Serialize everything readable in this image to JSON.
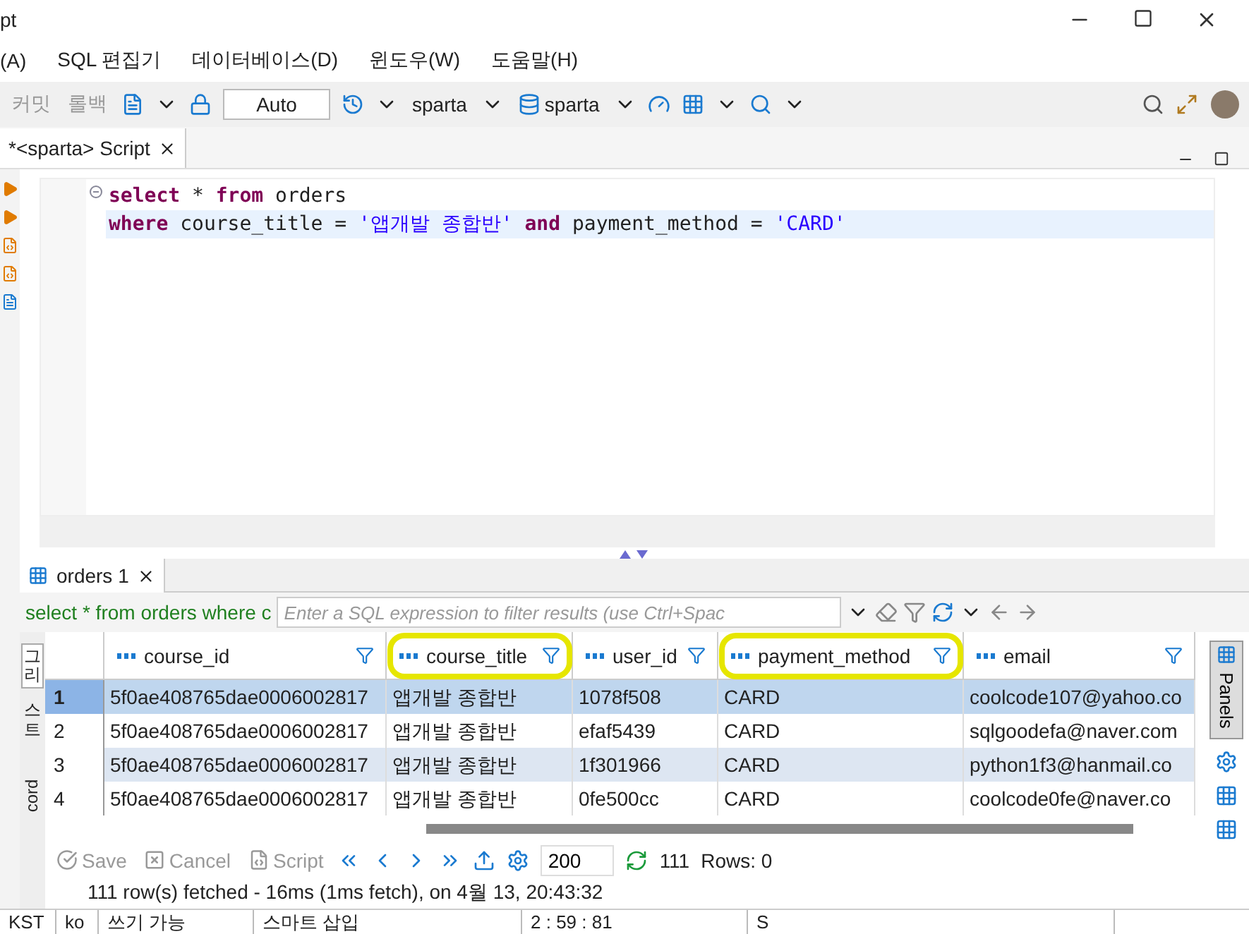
{
  "window": {
    "title": "pt"
  },
  "menu": [
    "(A)",
    "SQL 편집기",
    "데이터베이스(D)",
    "윈도우(W)",
    "도움말(H)"
  ],
  "toolbar": {
    "commit": "커밋",
    "rollback": "롤백",
    "mode": "Auto",
    "datasource": "sparta",
    "schema": "sparta"
  },
  "editor_tab": {
    "label": "*<sparta> Script",
    "selected": true
  },
  "code": [
    {
      "tokens": [
        {
          "kind": "keyword",
          "text": "select"
        },
        {
          "kind": "plain",
          "text": " * "
        },
        {
          "kind": "keyword",
          "text": "from"
        },
        {
          "kind": "plain",
          "text": " orders"
        }
      ],
      "current": false
    },
    {
      "tokens": [
        {
          "kind": "keyword",
          "text": "where"
        },
        {
          "kind": "plain",
          "text": " course_title = "
        },
        {
          "kind": "string",
          "text": "'앱개발 종합반'"
        },
        {
          "kind": "keyword",
          "text": " and"
        },
        {
          "kind": "plain",
          "text": " payment_method = "
        },
        {
          "kind": "string",
          "text": "'CARD'"
        }
      ],
      "current": true
    }
  ],
  "results_tab": {
    "label": "orders 1",
    "selected": true
  },
  "filter": {
    "query": "select * from orders where c",
    "placeholder": "Enter a SQL expression to filter results (use Ctrl+Spac"
  },
  "side_tabs": [
    {
      "label": "그리",
      "selected": true
    },
    {
      "label": "스트",
      "selected": false
    }
  ],
  "side_tab_extra": "cord",
  "table": {
    "columns": [
      {
        "name": "course_id",
        "highlighted": false
      },
      {
        "name": "course_title",
        "highlighted": true
      },
      {
        "name": "user_id",
        "highlighted": false
      },
      {
        "name": "payment_method",
        "highlighted": true
      },
      {
        "name": "email",
        "highlighted": false
      }
    ],
    "rows": [
      {
        "num": "1",
        "selected": true,
        "cells": [
          "5f0ae408765dae0006002817",
          "앱개발 종합반",
          "1078f508",
          "CARD",
          "coolcode107@yahoo.co"
        ]
      },
      {
        "num": "2",
        "selected": false,
        "cells": [
          "5f0ae408765dae0006002817",
          "앱개발 종합반",
          "efaf5439",
          "CARD",
          "sqlgoodefa@naver.com"
        ]
      },
      {
        "num": "3",
        "selected": false,
        "cells": [
          "5f0ae408765dae0006002817",
          "앱개발 종합반",
          "1f301966",
          "CARD",
          "python1f3@hanmail.co"
        ]
      },
      {
        "num": "4",
        "selected": false,
        "cells": [
          "5f0ae408765dae0006002817",
          "앱개발 종합반",
          "0fe500cc",
          "CARD",
          "coolcode0fe@naver.co"
        ]
      }
    ]
  },
  "results_toolbar": {
    "save": {
      "label": "Save",
      "disabled": true
    },
    "cancel": {
      "label": "Cancel",
      "disabled": true
    },
    "script": {
      "label": "Script",
      "disabled": true
    },
    "fetch_size": "200",
    "count": "111",
    "rows": "Rows: 0"
  },
  "status_message": "111 row(s) fetched - 16ms (1ms fetch), on 4월 13, 20:43:32",
  "panels_button": "Panels",
  "status_bar": [
    "KST",
    "ko",
    "쓰기 가능",
    "스마트 삽입",
    "2 : 59 : 81",
    "S"
  ]
}
